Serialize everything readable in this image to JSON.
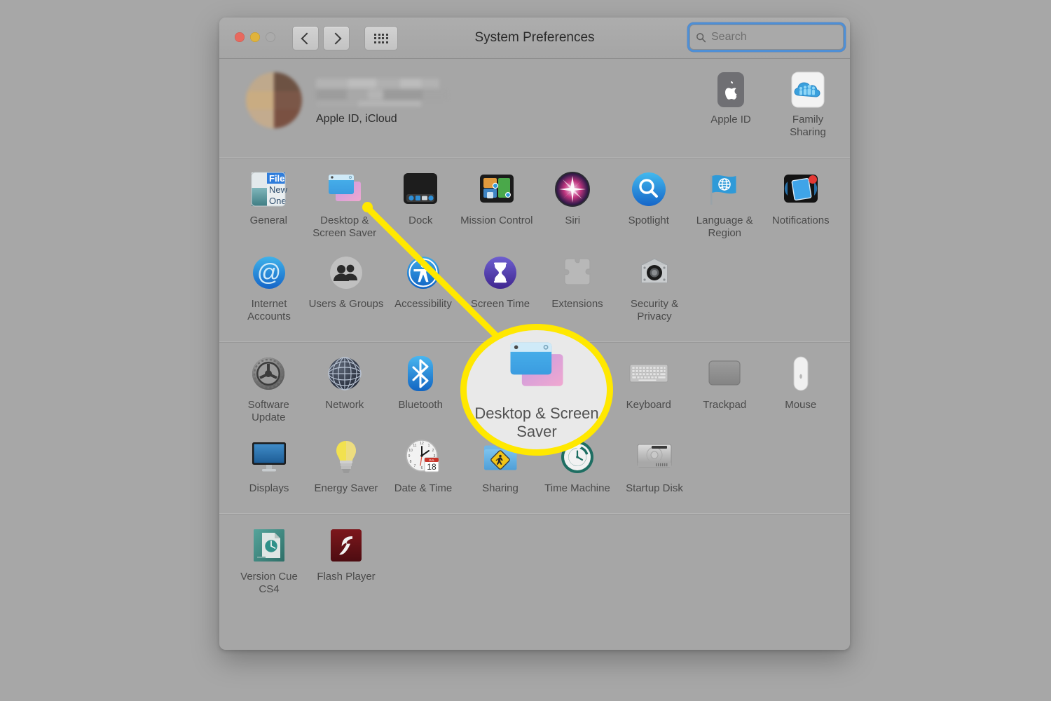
{
  "window": {
    "title": "System Preferences",
    "traffic_lights": [
      "close",
      "minimize",
      "zoom-disabled"
    ],
    "nav": {
      "back": "back-button",
      "forward": "forward-button",
      "grid": "show-all-button"
    },
    "search": {
      "placeholder": "Search",
      "value": "",
      "focused": true,
      "focus_color": "#4e8fd6"
    }
  },
  "account": {
    "name_redacted": true,
    "subtitle": "Apple ID, iCloud",
    "panes": [
      {
        "label": "Apple ID",
        "icon": "apple-logo-icon"
      },
      {
        "label": "Family Sharing",
        "icon": "family-cloud-icon"
      }
    ]
  },
  "sections": [
    {
      "id": "personal",
      "rows": [
        [
          {
            "label": "General",
            "icon": "general-icon"
          },
          {
            "label": "Desktop & Screen Saver",
            "icon": "desktop-screensaver-icon"
          },
          {
            "label": "Dock",
            "icon": "dock-icon"
          },
          {
            "label": "Mission Control",
            "icon": "mission-control-icon"
          },
          {
            "label": "Siri",
            "icon": "siri-icon"
          },
          {
            "label": "Spotlight",
            "icon": "spotlight-icon"
          },
          {
            "label": "Language & Region",
            "icon": "language-region-icon"
          },
          {
            "label": "Notifications",
            "icon": "notifications-icon"
          }
        ],
        [
          {
            "label": "Internet Accounts",
            "icon": "internet-accounts-icon"
          },
          {
            "label": "Users & Groups",
            "icon": "users-groups-icon"
          },
          {
            "label": "Accessibility",
            "icon": "accessibility-icon"
          },
          {
            "label": "Screen Time",
            "icon": "screen-time-icon"
          },
          {
            "label": "Extensions",
            "icon": "extensions-icon"
          },
          {
            "label": "Security & Privacy",
            "icon": "security-privacy-icon"
          }
        ]
      ]
    },
    {
      "id": "hardware",
      "rows": [
        [
          {
            "label": "Software Update",
            "icon": "software-update-icon"
          },
          {
            "label": "Network",
            "icon": "network-icon"
          },
          {
            "label": "Bluetooth",
            "icon": "bluetooth-icon"
          },
          {
            "label": "",
            "icon": ""
          },
          {
            "label": "",
            "icon": ""
          },
          {
            "label": "Keyboard",
            "icon": "keyboard-icon"
          },
          {
            "label": "Trackpad",
            "icon": "trackpad-icon"
          },
          {
            "label": "Mouse",
            "icon": "mouse-icon"
          }
        ],
        [
          {
            "label": "Displays",
            "icon": "displays-icon"
          },
          {
            "label": "Energy Saver",
            "icon": "energy-saver-icon"
          },
          {
            "label": "Date & Time",
            "icon": "date-time-icon"
          },
          {
            "label": "Sharing",
            "icon": "sharing-icon"
          },
          {
            "label": "Time Machine",
            "icon": "time-machine-icon"
          },
          {
            "label": "Startup Disk",
            "icon": "startup-disk-icon"
          }
        ]
      ]
    },
    {
      "id": "other",
      "rows": [
        [
          {
            "label": "Version Cue CS4",
            "icon": "version-cue-icon"
          },
          {
            "label": "Flash Player",
            "icon": "flash-player-icon"
          }
        ]
      ]
    }
  ],
  "callout": {
    "highlight_label": "Desktop & Screen Saver",
    "ring_color": "#ffe800",
    "dot_color": "#ffe800",
    "interior_color": "#e9e9e9"
  }
}
